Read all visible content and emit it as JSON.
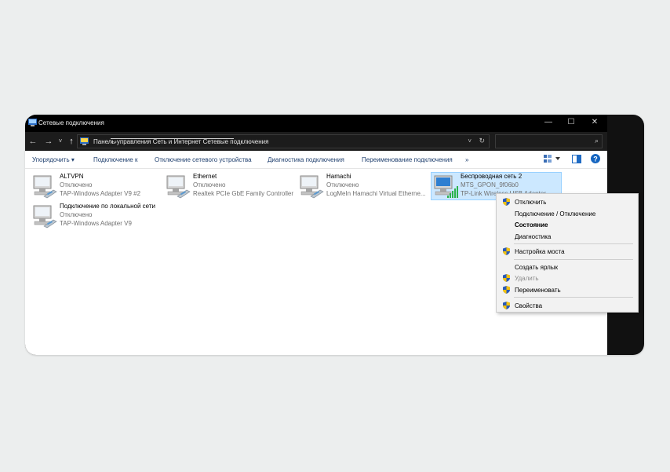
{
  "window": {
    "title": "Сетевые подключения",
    "controls": {
      "minimize": "—",
      "maximize": "☐",
      "close": "✕"
    }
  },
  "nav": {
    "back": "←",
    "forward": "→",
    "recent": "˅",
    "up": "↑",
    "breadcrumbs": [
      "Панель управления",
      "Сеть и Интернет",
      "Сетевые подключения"
    ],
    "separator": "›",
    "dropdown": "˅",
    "refresh": "↻",
    "search_placeholder": "",
    "search_icon": "⌕"
  },
  "commands": {
    "organize": "Упорядочить ▾",
    "connect_to": "Подключение к",
    "disable_device": "Отключение сетевого устройства",
    "diagnose": "Диагностика подключения",
    "rename": "Переименование подключения",
    "more": "»"
  },
  "connections": [
    {
      "name": "ALTVPN",
      "status": "Отключено",
      "device": "TAP-Windows Adapter V9 #2"
    },
    {
      "name": "Ethernet",
      "status": "Отключено",
      "device": "Realtek PCIe GbE Family Controller"
    },
    {
      "name": "Hamachi",
      "status": "Отключено",
      "device": "LogMeIn Hamachi Virtual Etherne..."
    },
    {
      "name": "Беспроводная сеть 2",
      "status": "MTS_GPON_9f06b0",
      "device": "TP-Link Wireless USB Adapter"
    },
    {
      "name": "Подключение по локальной сети",
      "status": "Отключено",
      "device": "TAP-Windows Adapter V9"
    }
  ],
  "context_menu": [
    {
      "label": "Отключить",
      "shield": true
    },
    {
      "label": "Подключение / Отключение",
      "shield": false
    },
    {
      "label": "Состояние",
      "shield": false,
      "bold": true
    },
    {
      "label": "Диагностика",
      "shield": false
    },
    {
      "label": "Настройка моста",
      "shield": true
    },
    {
      "label": "Создать ярлык",
      "shield": false
    },
    {
      "label": "Удалить",
      "shield": true,
      "disabled": true
    },
    {
      "label": "Переименовать",
      "shield": true
    },
    {
      "label": "Свойства",
      "shield": true
    }
  ],
  "colors": {
    "selection_bg": "#cce8ff",
    "selection_border": "#99d1ff",
    "command_text": "#1f3f6e",
    "titlebar": "#000000"
  }
}
